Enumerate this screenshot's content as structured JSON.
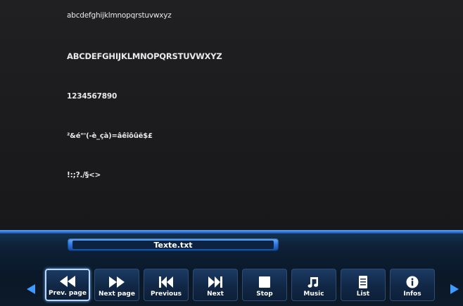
{
  "document": {
    "lines": [
      "abcdefghijklmnopqrstuvwxyz",
      "ABCDEFGHIJKLMNOPQRSTUVWXYZ",
      "1234567890",
      "²&é\"'(-è_çà)=âêîôûë$£",
      "!:;?./§<>"
    ]
  },
  "file": {
    "name": "Texte.txt"
  },
  "toolbar": {
    "buttons": [
      {
        "label": "Prev. page",
        "icon": "rewind-icon",
        "active": true
      },
      {
        "label": "Next page",
        "icon": "fast-forward-icon",
        "active": false
      },
      {
        "label": "Previous",
        "icon": "skip-back-icon",
        "active": false
      },
      {
        "label": "Next",
        "icon": "skip-forward-icon",
        "active": false
      },
      {
        "label": "Stop",
        "icon": "stop-icon",
        "active": false
      },
      {
        "label": "Music",
        "icon": "music-note-icon",
        "active": false
      },
      {
        "label": "List",
        "icon": "list-icon",
        "active": false
      },
      {
        "label": "Infos",
        "icon": "info-icon",
        "active": false
      }
    ]
  },
  "colors": {
    "accent": "#3f9bff",
    "text": "#e9e9e9",
    "panel": "#0d2036"
  }
}
